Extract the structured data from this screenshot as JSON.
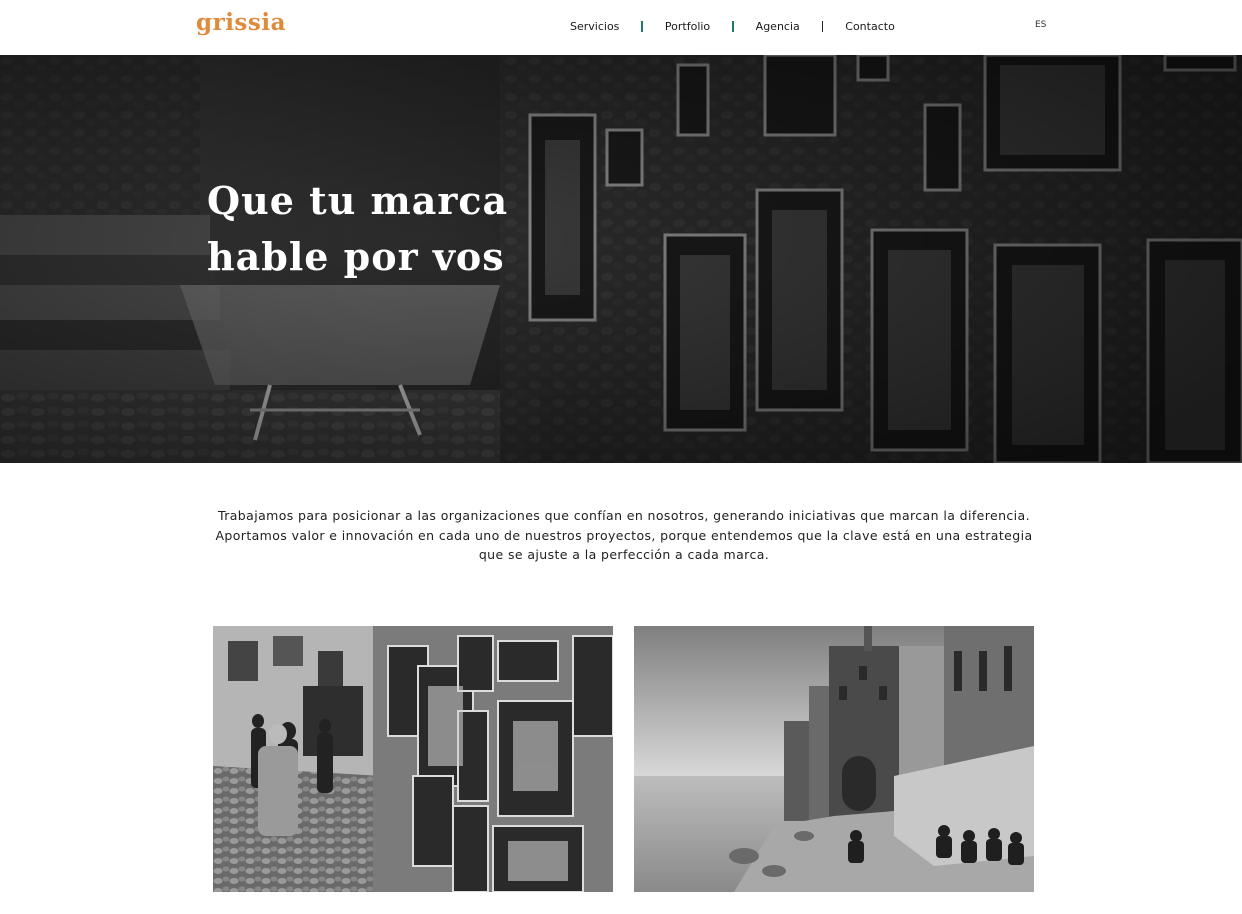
{
  "brand": {
    "logo_text": "grissia",
    "accent_color": "#e08a3c"
  },
  "nav": {
    "items": [
      {
        "label": "Servicios"
      },
      {
        "label": "Portfolio"
      },
      {
        "label": "Agencia"
      },
      {
        "label": "Contacto"
      }
    ],
    "separator_colors": [
      "#1e7b6c",
      "#1e7b6c",
      "#222222"
    ]
  },
  "language": {
    "current": "ES"
  },
  "hero": {
    "title_line1": "Que tu marca",
    "title_line2": "hable por vos",
    "image": "black-and-white photo of a narrow cobblestone alley with framed paintings hung on stone wall"
  },
  "intro": {
    "line1": "Trabajamos para posicionar a las organizaciones que confían en nosotros, generando iniciativas que marcan la diferencia.",
    "line2": "Aportamos valor e innovación en cada uno de nuestros proyectos, porque entendemos que la clave está en una estrategia",
    "line3": "que se ajuste a la perfección a cada marca."
  },
  "gallery": [
    {
      "image": "black-and-white street with tourists walking past paintings displayed on a stone wall"
    },
    {
      "image": "black-and-white coastal old town buildings by the sea with people sitting on rocks"
    }
  ]
}
